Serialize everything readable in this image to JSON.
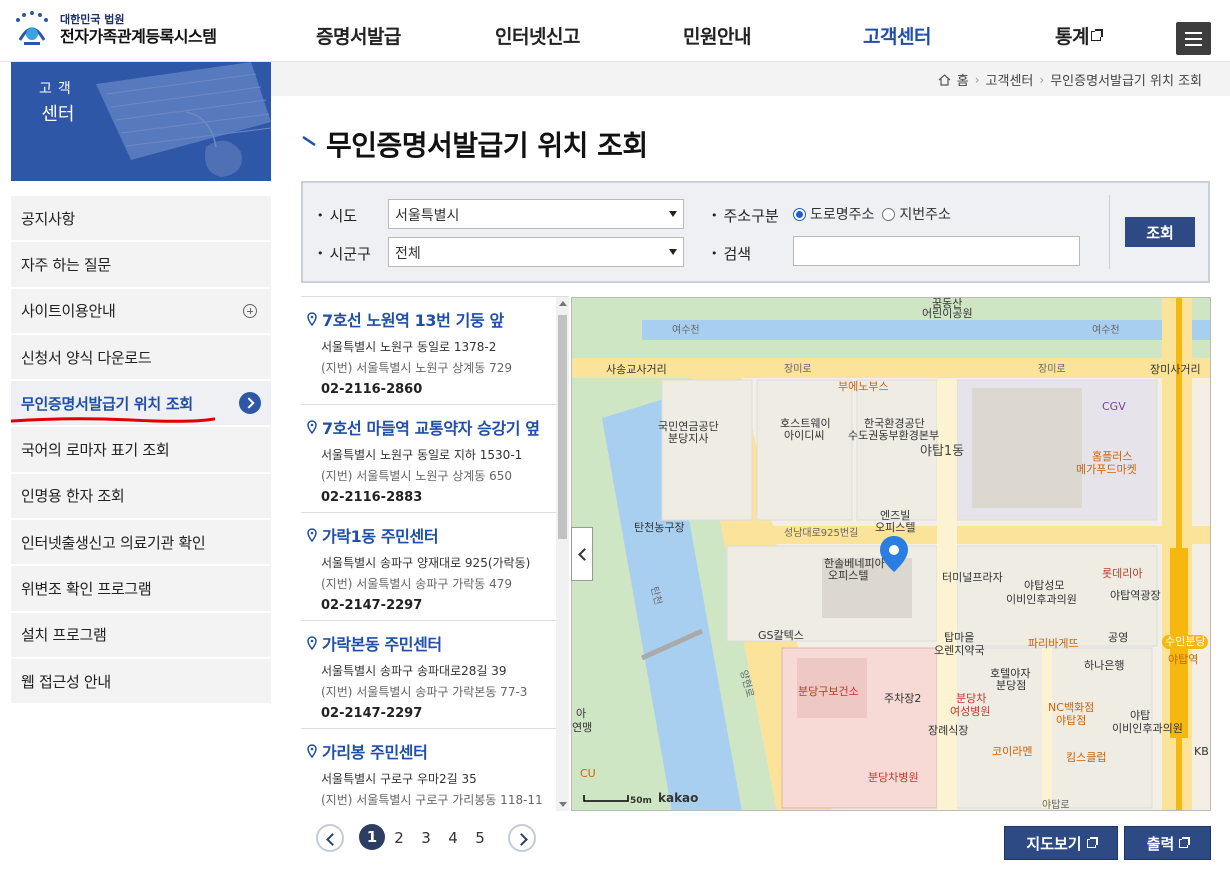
{
  "header": {
    "logo_sub": "대한민국 법원",
    "logo_main": "전자가족관계등록시스템",
    "nav": [
      {
        "label": "증명서발급",
        "active": false,
        "external": false
      },
      {
        "label": "인터넷신고",
        "active": false,
        "external": false
      },
      {
        "label": "민원안내",
        "active": false,
        "external": false
      },
      {
        "label": "고객센터",
        "active": true,
        "external": false
      },
      {
        "label": "통계",
        "active": false,
        "external": true
      }
    ],
    "menu_icon": "hamburger-icon"
  },
  "sidebar": {
    "banner_line1": "고객",
    "banner_line2": "센터",
    "items": [
      {
        "label": "공지사항"
      },
      {
        "label": "자주 하는 질문"
      },
      {
        "label": "사이트이용안내",
        "expandable": true
      },
      {
        "label": "신청서 양식 다운로드"
      },
      {
        "label": "무인증명서발급기 위치 조회",
        "active": true
      },
      {
        "label": "국어의 로마자 표기 조회"
      },
      {
        "label": "인명용 한자 조회"
      },
      {
        "label": "인터넷출생신고 의료기관 확인"
      },
      {
        "label": "위변조 확인 프로그램"
      },
      {
        "label": "설치 프로그램"
      },
      {
        "label": "웹 접근성 안내"
      }
    ]
  },
  "breadcrumb": {
    "home": "홈",
    "level1": "고객센터",
    "level2": "무인증명서발급기 위치 조회"
  },
  "page_title": "무인증명서발급기 위치 조회",
  "search": {
    "sido_label": "시도",
    "sido_value": "서울특별시",
    "sigungu_label": "시군구",
    "sigungu_value": "전체",
    "addr_type_label": "주소구분",
    "addr_road": "도로명주소",
    "addr_jibun": "지번주소",
    "keyword_label": "검색",
    "keyword_value": "",
    "submit": "조회"
  },
  "results": [
    {
      "name": "7호선 노원역 13번 기둥 앞",
      "road": "서울특별시 노원구 동일로 1378-2",
      "jibun": "(지번) 서울특별시 노원구 상계동 729",
      "phone": "02-2116-2860"
    },
    {
      "name": "7호선 마들역 교통약자 승강기 옆",
      "road": "서울특별시 노원구 동일로 지하 1530-1",
      "jibun": "(지번) 서울특별시 노원구 상계동 650",
      "phone": "02-2116-2883"
    },
    {
      "name": "가락1동 주민센터",
      "road": "서울특별시 송파구 양재대로 925(가락동)",
      "jibun": "(지번) 서울특별시 송파구 가락동 479",
      "phone": "02-2147-2297"
    },
    {
      "name": "가락본동 주민센터",
      "road": "서울특별시 송파구 송파대로28길 39",
      "jibun": "(지번) 서울특별시 송파구 가락본동 77-3",
      "phone": "02-2147-2297"
    },
    {
      "name": "가리봉 주민센터",
      "road": "서울특별시 구로구 우마2길 35",
      "jibun": "(지번) 서울특별시 구로구 가리봉동 118-11",
      "phone": ""
    }
  ],
  "map": {
    "labels": {
      "l1": "꿈동산",
      "l2": "어린이공원",
      "l3": "여수천",
      "l4": "여수천",
      "l5": "사송교사거리",
      "l6": "장미로",
      "l7": "장미로",
      "l8": "장미사거리",
      "l9": "부에노부스",
      "l10": "국민연금공단",
      "l11": "분당지사",
      "l12": "호스트웨이",
      "l13": "아이디씨",
      "l14": "한국환경공단",
      "l15": "수도권동부환경본부",
      "l16": "CGV",
      "l17": "야탑1동",
      "l18": "홈플러스",
      "l19": "메가푸드마켓",
      "l20": "탄천농구장",
      "l21": "성남대로925번길",
      "l22": "엔즈빌",
      "l23": "오피스텔",
      "l24": "한솔베네피아",
      "l25": "오피스텔",
      "l26": "터미널프라자",
      "l27": "야탑성모",
      "l28": "이비인후과의원",
      "l29": "롯데리아",
      "l30": "야탑역광장",
      "l31": "GS칼텍스",
      "l32": "탑마을",
      "l33": "오렌지약국",
      "l34": "파리바게뜨",
      "l35": "공영",
      "l36": "수인분당",
      "l37": "야탑역",
      "l38": "호텔야자",
      "l39": "분당점",
      "l40": "하나은행",
      "l41": "분당구보건소",
      "l42": "주차장2",
      "l43": "분당차",
      "l44": "여성병원",
      "l45": "NC백화점",
      "l46": "야탑점",
      "l47": "야탑",
      "l48": "이비인후과의원",
      "l49": "장례식장",
      "l50": "코이라멘",
      "l51": "킴스클럽",
      "l52": "분당차병원",
      "l53": "아",
      "l54": "연맹",
      "l55": "CU",
      "l56": "탄천",
      "l57": "양현로",
      "l58": "KB",
      "l59": "야탑로"
    },
    "scale": "50m",
    "brand": "kakao"
  },
  "pagination": {
    "pages": [
      "1",
      "2",
      "3",
      "4",
      "5"
    ],
    "current": "1"
  },
  "actions": {
    "map_view": "지도보기",
    "print": "출력"
  },
  "colors": {
    "primary": "#2f57a7",
    "button": "#2d4a85",
    "active_text": "#1f4fa8",
    "highlight_underline": "#e00000"
  }
}
